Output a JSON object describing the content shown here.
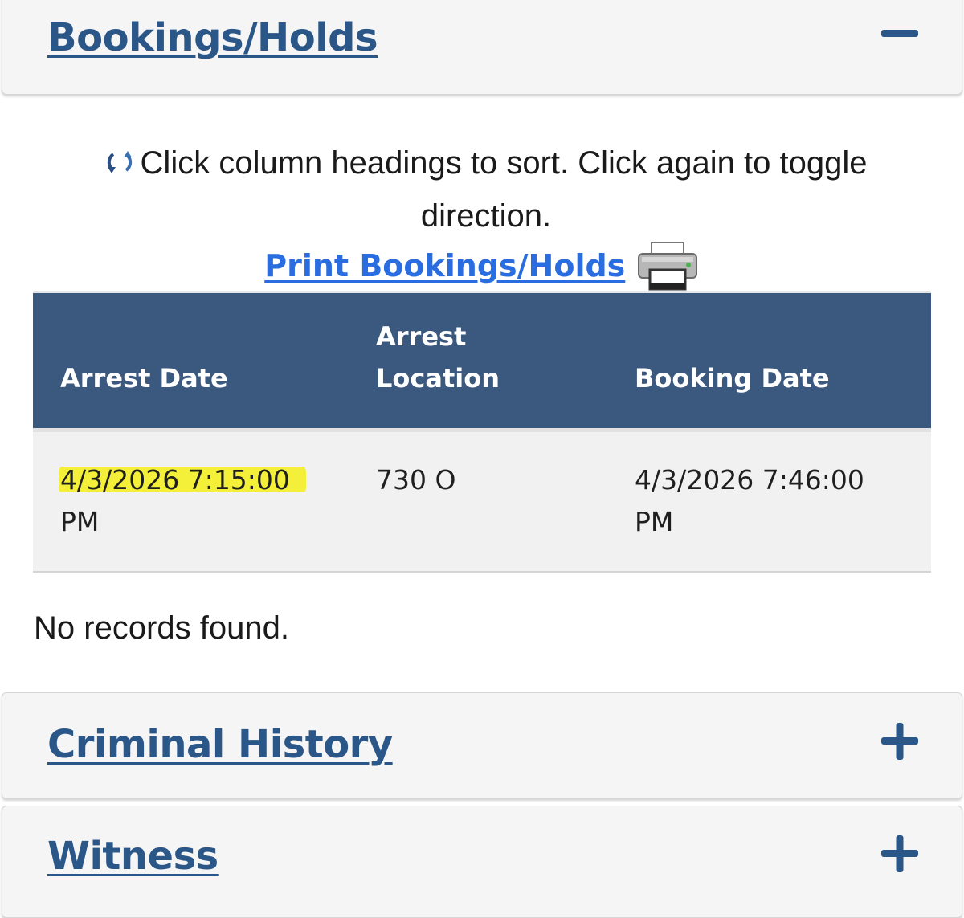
{
  "sections": {
    "bookings": {
      "title": "Bookings/Holds",
      "expanded": true
    },
    "criminal_history": {
      "title": "Criminal History",
      "expanded": false
    },
    "witness": {
      "title": "Witness",
      "expanded": false
    }
  },
  "sort_hint": "Click column headings to sort. Click again to toggle direction.",
  "print_link": "Print Bookings/Holds",
  "table": {
    "headers": {
      "arrest_date": "Arrest Date",
      "arrest_location_line1": "Arrest",
      "arrest_location_line2": "Location",
      "booking_date": "Booking Date"
    },
    "rows": [
      {
        "arrest_date": "4/3/2026 7:15:00",
        "arrest_date_suffix": "PM",
        "arrest_location": "730 O",
        "booking_date": "4/3/2026 7:46:00",
        "booking_date_suffix": "PM"
      }
    ]
  },
  "no_records": "No records found.",
  "colors": {
    "panel_title": "#2b5688",
    "table_header_bg": "#3b587f",
    "link": "#2a6de0",
    "highlight": "#f4f03a"
  },
  "icons": {
    "collapse": "minus-icon",
    "expand": "plus-icon",
    "sort": "sort-refresh-icon",
    "print": "printer-icon"
  }
}
